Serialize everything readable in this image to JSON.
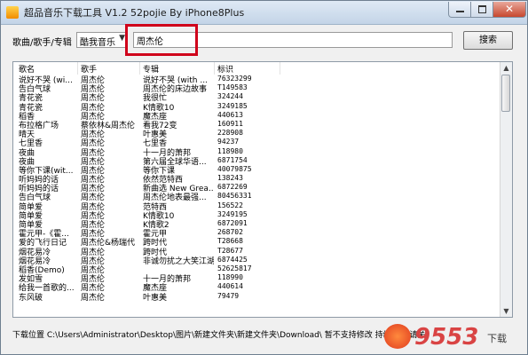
{
  "window": {
    "title": "超品音乐下载工具 V1.2 52pojie By iPhone8Plus"
  },
  "search": {
    "label": "歌曲/歌手/专辑",
    "source_selected": "酷我音乐",
    "query_value": "周杰伦",
    "button_label": "搜索"
  },
  "table": {
    "columns": [
      "歌名",
      "歌手",
      "专辑",
      "标识"
    ],
    "rows": [
      [
        "说好不哭 (wi...",
        "周杰伦",
        "说好不哭 (with ...",
        "76323299"
      ],
      [
        "告白气球",
        "周杰伦",
        "周杰伦的床边故事",
        "T149583"
      ],
      [
        "青花瓷",
        "周杰伦",
        "我很忙",
        "324244"
      ],
      [
        "青花瓷",
        "周杰伦",
        "K情歌10",
        "3249185"
      ],
      [
        "稻香",
        "周杰伦",
        "魔杰座",
        "440613"
      ],
      [
        "布拉格广场",
        "蔡依林&周杰伦",
        "看我72变",
        "160911"
      ],
      [
        "晴天",
        "周杰伦",
        "叶惠美",
        "228908"
      ],
      [
        "七里香",
        "周杰伦",
        "七里香",
        "94237"
      ],
      [
        "夜曲",
        "周杰伦",
        "十一月的萧邦",
        "118980"
      ],
      [
        "夜曲",
        "周杰伦",
        "第六届全球华语...",
        "6871754"
      ],
      [
        "等你下课(wit...",
        "周杰伦",
        "等你下课",
        "40079875"
      ],
      [
        "听妈妈的话",
        "周杰伦",
        "依然范特西",
        "138243"
      ],
      [
        "听妈妈的话",
        "周杰伦",
        "新曲选 New Grea...",
        "6872269"
      ],
      [
        "告白气球",
        "周杰伦",
        "周杰伦地表最强...",
        "80456331"
      ],
      [
        "简单爱",
        "周杰伦",
        "范特西",
        "156522"
      ],
      [
        "简单爱",
        "周杰伦",
        "K情歌10",
        "3249195"
      ],
      [
        "简单爱",
        "周杰伦",
        "K情歌2",
        "6872091"
      ],
      [
        "霍元甲-《霍...",
        "周杰伦",
        "霍元甲",
        "268702"
      ],
      [
        "爱的飞行日记",
        "周杰伦&杨瑞代",
        "跨时代",
        "T28668"
      ],
      [
        "烟花易冷",
        "周杰伦",
        "跨时代",
        "T28677"
      ],
      [
        "烟花易冷",
        "周杰伦",
        "非诚勿扰之大笑江湖",
        "6874425"
      ],
      [
        "稻香(Demo)",
        "周杰伦",
        "",
        "52625817"
      ],
      [
        "发如雪",
        "周杰伦",
        "十一月的萧邦",
        "118990"
      ],
      [
        "给我一首歌的...",
        "周杰伦",
        "魔杰座",
        "440614"
      ],
      [
        "东风破",
        "周杰伦",
        "叶惠美",
        "79479"
      ]
    ]
  },
  "status": {
    "text": "下载位置 C:\\Users\\Administrator\\Desktop\\图片\\新建文件夹\\新建文件夹\\Download\\ 暂不支持修改 持续更新 请关"
  },
  "watermark": {
    "text": "9553",
    "suffix": "下载"
  },
  "colors": {
    "highlight": "#d0021b",
    "title_bar": "#c3d4e7",
    "close_button": "#c7472e"
  }
}
